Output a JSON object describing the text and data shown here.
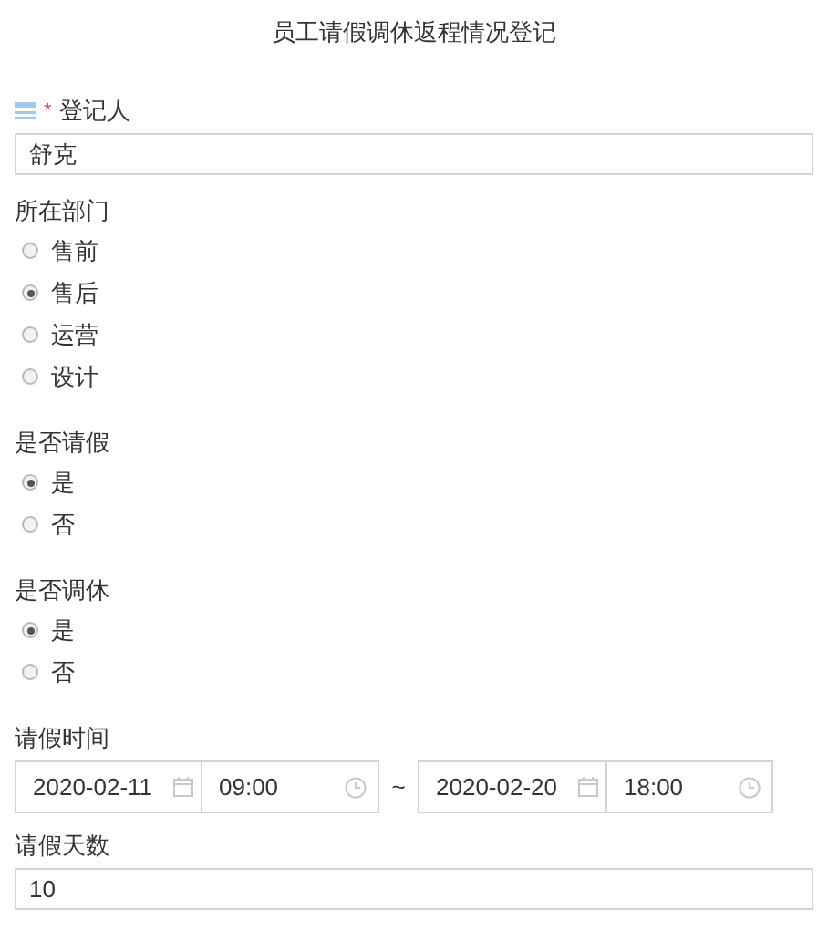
{
  "title": "员工请假调休返程情况登记",
  "fields": [
    {
      "kind": "text",
      "label": "登记人",
      "required": "*",
      "title_icon": true,
      "value": "舒克"
    },
    {
      "kind": "radio",
      "label": "所在部门",
      "options": [
        {
          "label": "售前",
          "selected": false
        },
        {
          "label": "售后",
          "selected": true
        },
        {
          "label": "运营",
          "selected": false
        },
        {
          "label": "设计",
          "selected": false
        }
      ]
    },
    {
      "kind": "radio",
      "label": "是否请假",
      "options": [
        {
          "label": "是",
          "selected": true
        },
        {
          "label": "否",
          "selected": false
        }
      ]
    },
    {
      "kind": "radio",
      "label": "是否调休",
      "options": [
        {
          "label": "是",
          "selected": true
        },
        {
          "label": "否",
          "selected": false
        }
      ]
    },
    {
      "kind": "range",
      "label": "请假时间",
      "start_date": "2020-02-11",
      "start_time": "09:00",
      "separator": "~",
      "end_date": "2020-02-20",
      "end_time": "18:00"
    },
    {
      "kind": "text",
      "label": "请假天数",
      "value": "10"
    }
  ]
}
